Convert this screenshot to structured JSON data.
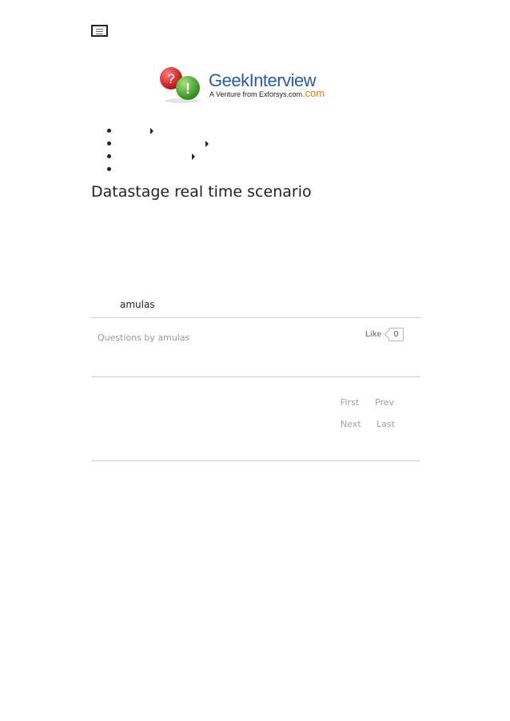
{
  "header": {
    "menu_icon": "hamburger-menu-icon",
    "logo": {
      "name": "GeekInterview",
      "tagline": "A Venture from Exforsys.com",
      "suffix": ".com"
    }
  },
  "nav": {
    "items": [
      {
        "label": "",
        "has_submenu": true
      },
      {
        "label": "",
        "has_submenu": true
      },
      {
        "label": "",
        "has_submenu": true
      },
      {
        "label": "",
        "has_submenu": false
      }
    ]
  },
  "page": {
    "title": "Datastage real time scenario"
  },
  "post": {
    "author": "amulas",
    "questions_by": "Questions by amulas",
    "like_label": "Like",
    "like_count": "0"
  },
  "pagination": {
    "first": "First",
    "prev": "Prev",
    "next": "Next",
    "last": "Last"
  },
  "colors": {
    "logo_blue": "#2a5aa0",
    "logo_orange": "#e07a10",
    "muted_text": "#9a9a9a",
    "divider": "#cfcfcf"
  }
}
